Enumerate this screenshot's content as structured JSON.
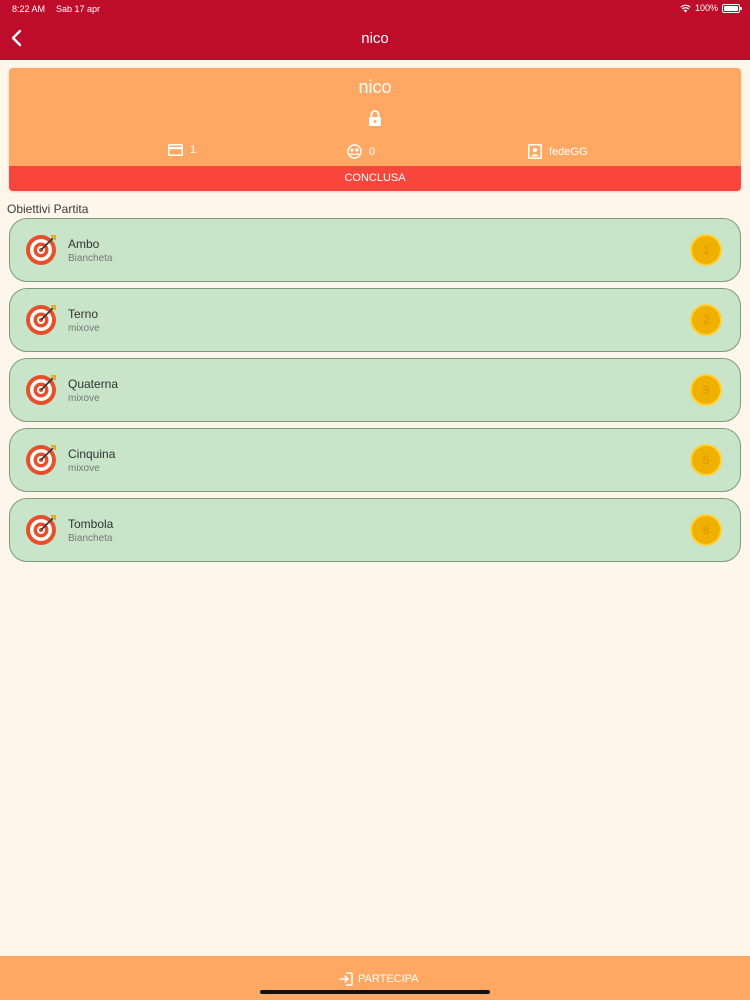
{
  "status_bar": {
    "time": "8:22 AM",
    "date": "Sab 17 apr",
    "battery": "100%"
  },
  "nav": {
    "title": "nico"
  },
  "game": {
    "name": "nico",
    "cards": "1",
    "players": "0",
    "owner": "fedeGG",
    "status": "CONCLUSA"
  },
  "section_title": "Obiettivi Partita",
  "goals": [
    {
      "name": "Ambo",
      "winner": "Biancheta",
      "number": "1"
    },
    {
      "name": "Terno",
      "winner": "mixove",
      "number": "2"
    },
    {
      "name": "Quaterna",
      "winner": "mixove",
      "number": "3"
    },
    {
      "name": "Cinquina",
      "winner": "mixove",
      "number": "5"
    },
    {
      "name": "Tombola",
      "winner": "Biancheta",
      "number": "8"
    }
  ],
  "actions": {
    "join_label": "PARTECIPA"
  },
  "colors": {
    "header": "#bd0d2a",
    "card": "#fea864",
    "status_strip": "#f8463c",
    "goal_bg": "#c8e5ca",
    "badge": "#f0b000",
    "background": "#fef6ea"
  },
  "icons": {
    "back": "chevron-left-icon",
    "lock": "lock-icon",
    "cards": "credit-card-icon",
    "players": "players-icon",
    "owner": "user-badge-icon",
    "goal": "target-icon",
    "join": "login-icon"
  }
}
